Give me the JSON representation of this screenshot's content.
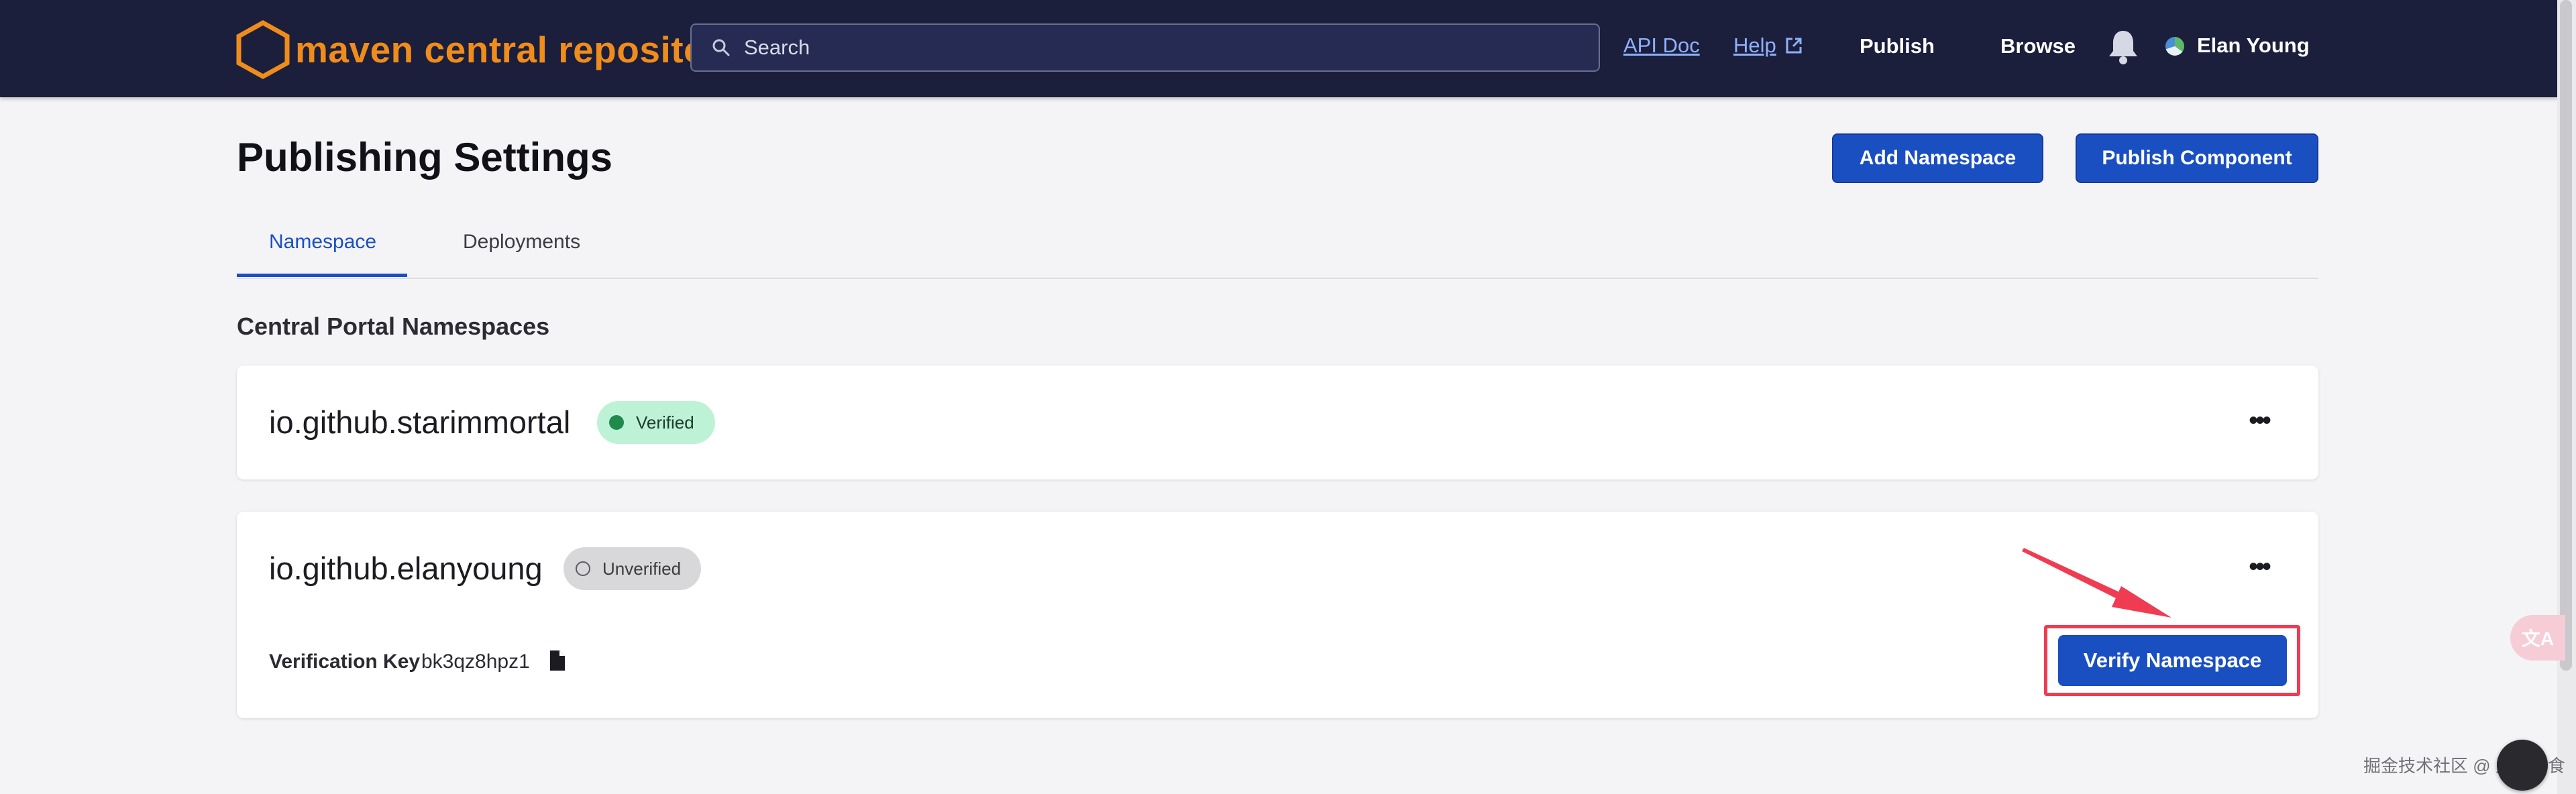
{
  "header": {
    "logo_text": "maven central repository",
    "search_placeholder": "Search",
    "api_doc_link": "API Doc",
    "help_link": "Help",
    "publish_label": "Publish",
    "browse_label": "Browse",
    "user_name": "Elan Young"
  },
  "page": {
    "title": "Publishing Settings",
    "add_namespace_label": "Add Namespace",
    "publish_component_label": "Publish Component",
    "tabs": [
      {
        "label": "Namespace",
        "active": true
      },
      {
        "label": "Deployments",
        "active": false
      }
    ],
    "section_title": "Central Portal Namespaces"
  },
  "namespaces": [
    {
      "name": "io.github.starimmortal",
      "status": "Verified"
    },
    {
      "name": "io.github.elanyoung",
      "status": "Unverified",
      "verification_key_label": "Verification Key",
      "verification_key": "bk3qz8hpz1",
      "verify_button_label": "Verify Namespace"
    }
  ],
  "overlay": {
    "watermark": "掘金技术社区 @ 爱吃甜食",
    "translate_label": "文A"
  },
  "colors": {
    "header_bg": "#1b1f3b",
    "brand_orange": "#f08c1c",
    "primary_blue": "#1a4fc2",
    "verified_badge": "#bdf2d6",
    "annotation_red": "#ef3c53"
  },
  "icons": [
    "maven-logo-icon",
    "search-icon",
    "external-link-icon",
    "bell-icon",
    "more-icon",
    "document-icon",
    "translate-icon"
  ]
}
